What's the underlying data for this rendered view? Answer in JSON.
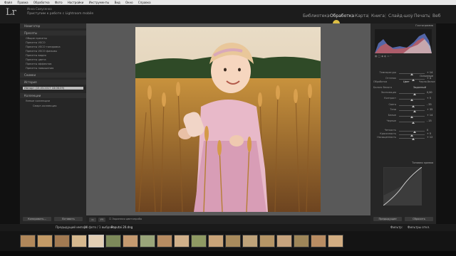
{
  "menubar": {
    "items": [
      "Файл",
      "Правка",
      "Обработка",
      "Фото",
      "Настройки",
      "Инструменты",
      "Вид",
      "Окно",
      "Справка"
    ]
  },
  "identity": {
    "line1": "Инна Самусенко",
    "line2": "Приступим к работе с Lightroom mobile"
  },
  "modules": [
    "Библиотека",
    "Обработка",
    "Карта",
    "Книга",
    "Слайд-шоу",
    "Печать",
    "Веб"
  ],
  "active_module": "Обработка",
  "left_panel": {
    "navigator": "Навигатор",
    "presets": "Пресеты",
    "preset_items": [
      "Общие пресеты",
      "Пресеты VSCO",
      "Пресеты VSCO тонировка",
      "Пресеты VSCO фильмы",
      "Пресеты видео",
      "Пресеты цвета",
      "Пресеты эффектов",
      "Пресеты повышения"
    ],
    "snapshots": "Снимки",
    "history": "История",
    "history_item": "Импорт (15.03.2017 18:06:09)",
    "collections": "Коллекции",
    "collection_items": [
      "Умные коллекции",
      "Смарт-коллекция"
    ],
    "copy_btn": "Копировать...",
    "paste_btn": "Вставить"
  },
  "right_panel": {
    "histogram": "Гистограмма",
    "basic": "Основные",
    "treatment": "Обработка",
    "color": "Цвет",
    "bw": "Черно-белое",
    "wb": "Баланс белого",
    "wb_value": "Заданный",
    "sliders": [
      {
        "label": "Температура",
        "value": "+ 14"
      },
      {
        "label": "Оттенок",
        "value": "+ 4"
      },
      {
        "label": "Экспозиция",
        "value": "0,00"
      },
      {
        "label": "Контраст",
        "value": "+ 5"
      },
      {
        "label": "Света",
        "value": "- 35"
      },
      {
        "label": "Тени",
        "value": "+ 35"
      },
      {
        "label": "Белые",
        "value": "+ 14"
      },
      {
        "label": "Черные",
        "value": "- 15"
      },
      {
        "label": "Четкость",
        "value": "0"
      },
      {
        "label": "Красочность",
        "value": "+ 5"
      },
      {
        "label": "Насыщенность",
        "value": "+ 12"
      }
    ],
    "tone_curve": "Тоновая кривая",
    "prev_btn": "Предыдущие",
    "reset_btn": "Сбросить"
  },
  "toolbar": {
    "soft_proof": "Экранная цветопроба"
  },
  "filmstrip": {
    "folder": "Предыдущий импорт",
    "count": "16 фото / 1 выбрано",
    "filename": "Poputai 20.dng",
    "filter": "Фильтр:",
    "filter_value": "Фильтры откл."
  },
  "colors": {
    "accent": "#f2d04a",
    "panel": "#262626",
    "background": "#595959"
  }
}
